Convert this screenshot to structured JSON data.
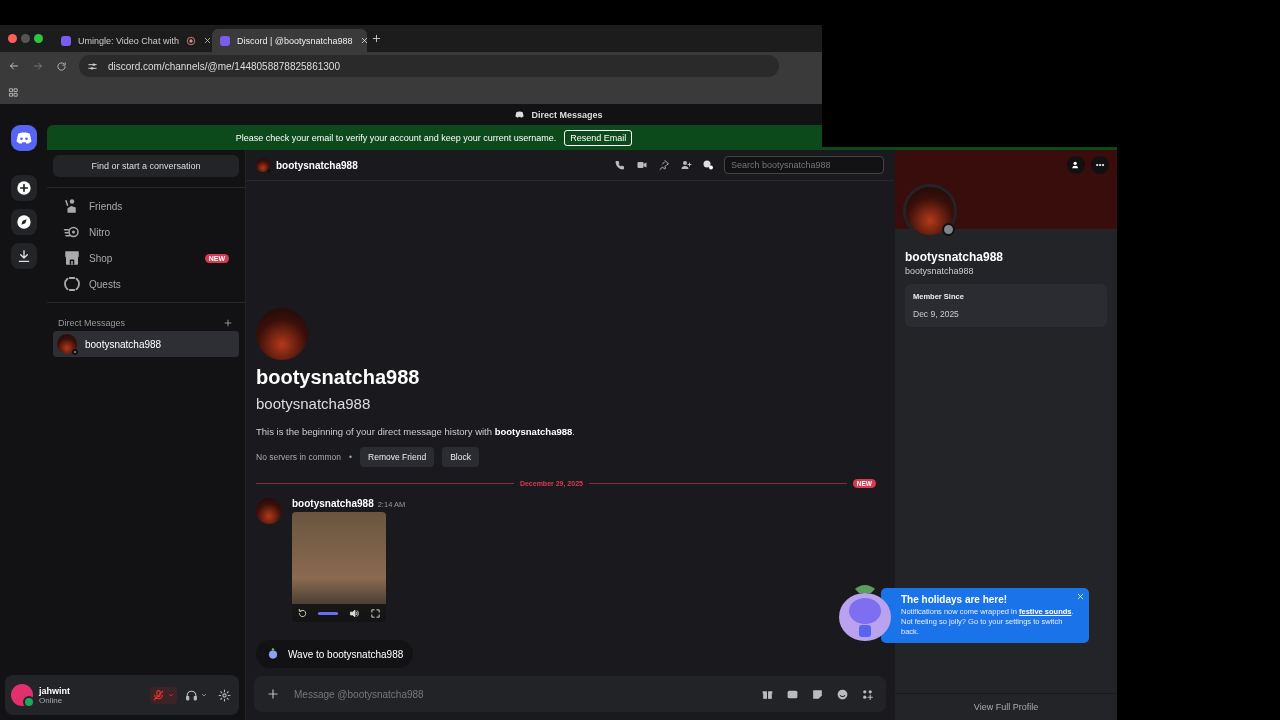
{
  "browser": {
    "tabs": [
      {
        "title": "Umingle: Video Chat with",
        "selected": false,
        "recording": true
      },
      {
        "title": "Discord | @bootysnatcha988",
        "selected": true,
        "recording": false
      }
    ],
    "url": "discord.com/channels/@me/1448058878825861300"
  },
  "app_title": "Direct Messages",
  "banner": {
    "text": "Please check your email to verify your account and keep your current username.",
    "button": "Resend Email"
  },
  "server_rail": [
    {
      "kind": "home",
      "selected": true
    },
    {
      "kind": "add",
      "selected": false
    },
    {
      "kind": "discover",
      "selected": false
    },
    {
      "kind": "download",
      "selected": false
    }
  ],
  "sidebar": {
    "search": "Find or start a conversation",
    "nav": [
      {
        "kind": "friends",
        "label": "Friends",
        "selected": false
      },
      {
        "kind": "nitro",
        "label": "Nitro",
        "selected": false
      },
      {
        "kind": "shop",
        "label": "Shop",
        "badge": "NEW",
        "selected": false
      },
      {
        "kind": "quests",
        "label": "Quests",
        "selected": false
      }
    ],
    "section": "Direct Messages",
    "dms": [
      {
        "name": "bootysnatcha988",
        "selected": true
      }
    ]
  },
  "user_panel": {
    "name": "jahwint",
    "status": "Online",
    "muted": true
  },
  "channel": {
    "name": "bootysnatcha988",
    "search_placeholder": "Search bootysnatcha988"
  },
  "intro": {
    "display_name": "bootysnatcha988",
    "username": "bootysnatcha988",
    "text": "This is the beginning of your direct message history with **bootysnatcha988**.",
    "servers": "No servers in common",
    "separator": "•",
    "buttons": [
      "Remove Friend",
      "Block"
    ]
  },
  "divider": {
    "date": "December 29, 2025",
    "badge": "NEW"
  },
  "messages": [
    {
      "author": "bootysnatcha988",
      "time": "2:14 AM",
      "video_progress": {
        "level": 1
      }
    }
  ],
  "wave_button": "Wave to bootysnatcha988",
  "composer": {
    "placeholder": "Message @bootysnatcha988"
  },
  "profile": {
    "display_name": "bootysnatcha988",
    "username": "bootysnatcha988",
    "member_since_label": "Member Since",
    "member_since": "Dec 9, 2025",
    "view_full": "View Full Profile"
  },
  "toast": {
    "title": "The holidays are here!",
    "text_before": "Notifications now come wrapped in",
    "link": "festive sounds",
    "text_after": ". Not feeling so jolly? Go to your settings to switch back."
  }
}
